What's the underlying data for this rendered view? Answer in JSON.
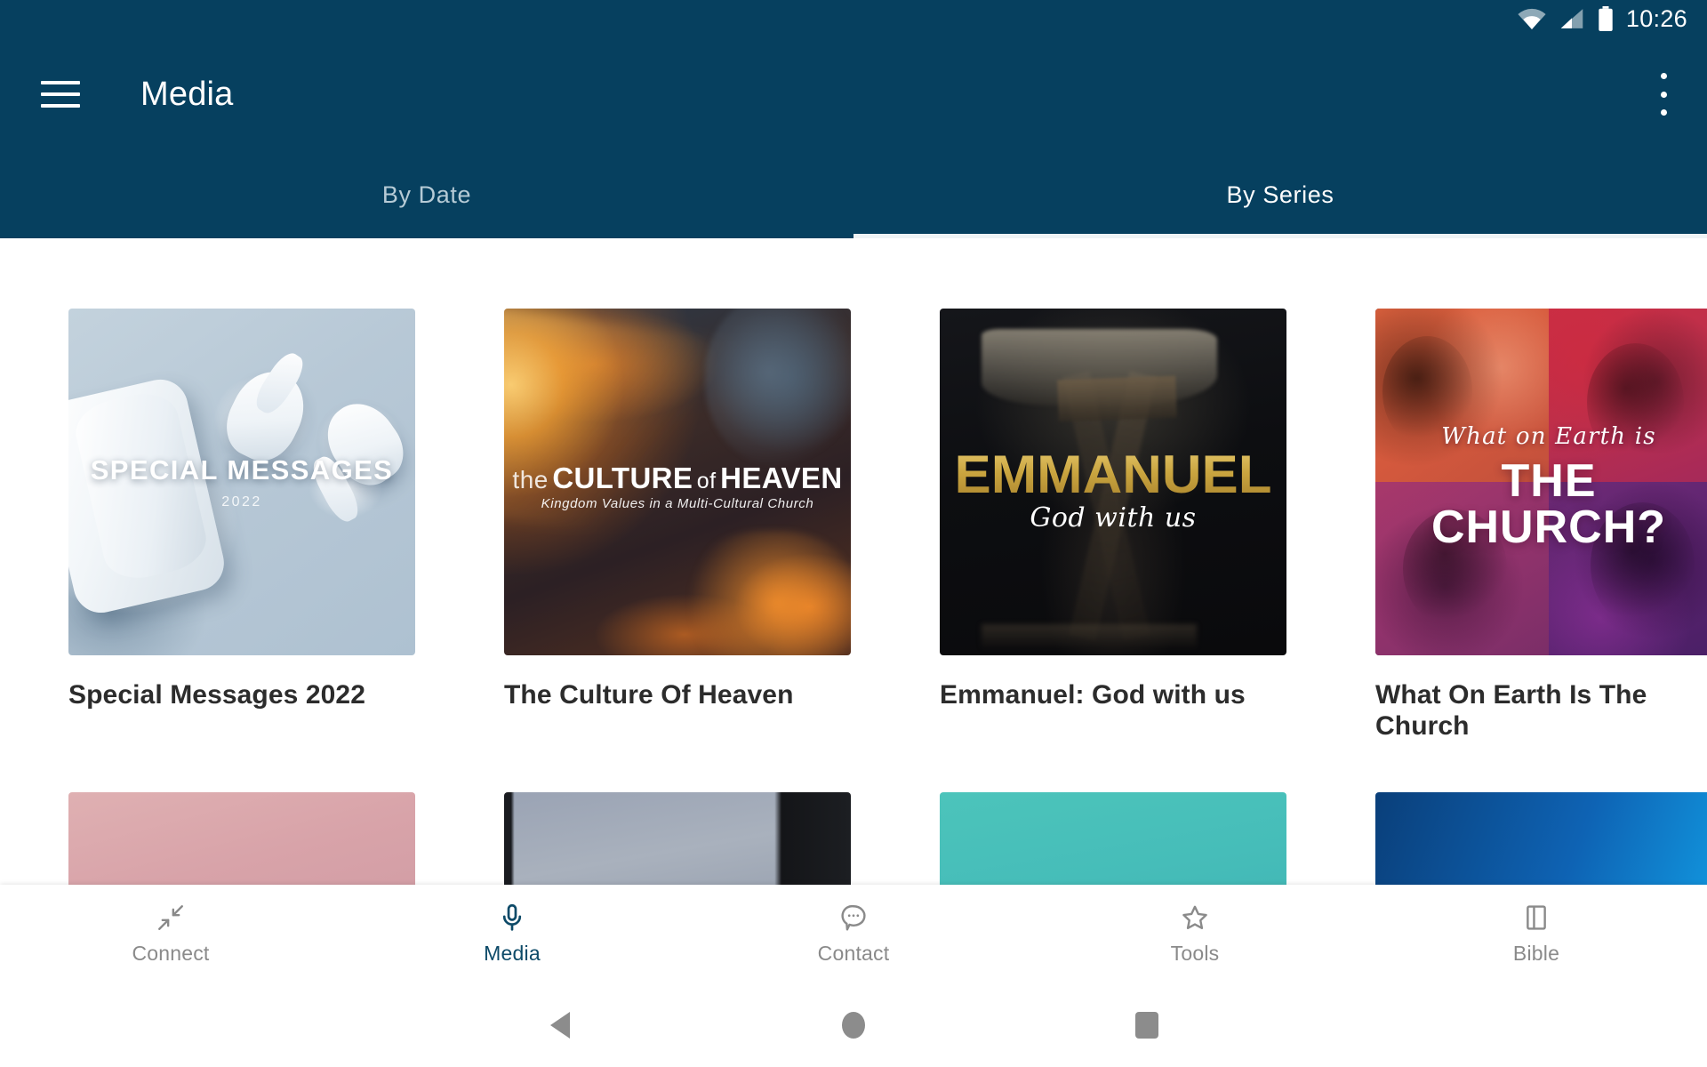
{
  "status_bar": {
    "time": "10:26",
    "icons": [
      "wifi-icon",
      "cellular-signal-icon",
      "battery-icon"
    ]
  },
  "app_bar": {
    "menu_icon": "hamburger-menu-icon",
    "title": "Media",
    "overflow_icon": "overflow-menu-icon"
  },
  "tabs": {
    "items": [
      {
        "label": "By Date",
        "active": false
      },
      {
        "label": "By Series",
        "active": true
      }
    ]
  },
  "series_grid": {
    "cards": [
      {
        "title": "Special Messages 2022",
        "art": {
          "style": "airpods",
          "overlay_title": "SPECIAL MESSAGES",
          "overlay_subtitle": "2022"
        }
      },
      {
        "title": "The Culture Of Heaven",
        "art": {
          "style": "clouds",
          "overlay_the": "the",
          "overlay_culture": "CULTURE",
          "overlay_of": "of",
          "overlay_heaven": "HEAVEN",
          "overlay_subtitle": "Kingdom Values in a Multi-Cultural Church"
        }
      },
      {
        "title": "Emmanuel: God with us",
        "art": {
          "style": "emmanuel",
          "overlay_title": "EMMANUEL",
          "overlay_subtitle": "God with us"
        }
      },
      {
        "title": "What On Earth Is The Church",
        "art": {
          "style": "church",
          "overlay_script": "What on Earth is",
          "overlay_line1": "THE",
          "overlay_line2": "CHURCH?"
        }
      }
    ],
    "second_row_partial": [
      {
        "tone": "rose"
      },
      {
        "tone": "slate"
      },
      {
        "tone": "teal"
      },
      {
        "tone": "blue"
      }
    ]
  },
  "bottom_nav": {
    "items": [
      {
        "label": "Connect",
        "icon": "collapse-arrows-icon",
        "active": false
      },
      {
        "label": "Media",
        "icon": "microphone-icon",
        "active": true
      },
      {
        "label": "Contact",
        "icon": "chat-bubble-icon",
        "active": false
      },
      {
        "label": "Tools",
        "icon": "star-outline-icon",
        "active": false
      },
      {
        "label": "Bible",
        "icon": "book-sidebar-icon",
        "active": false
      }
    ]
  },
  "system_nav": {
    "back": "back-triangle-icon",
    "home": "home-circle-icon",
    "recents": "recents-square-icon"
  },
  "colors": {
    "app_bar": "#06405f",
    "accent_active": "#0d4a68",
    "inactive_text": "#8a8a8a",
    "tab_inactive": "#b6cbd6",
    "card_title": "#2c2c2c"
  }
}
